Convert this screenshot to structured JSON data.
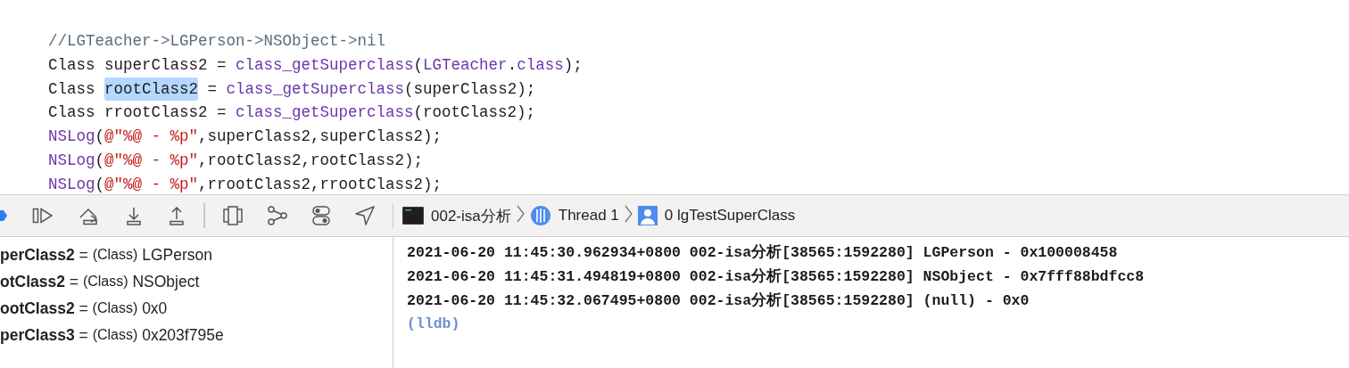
{
  "code_lines": [
    [
      {
        "kind": "comment",
        "text": "//LGTeacher->LGPerson->NSObject->nil"
      }
    ],
    [
      {
        "kind": "plain",
        "text": "Class superClass2 = "
      },
      {
        "kind": "func",
        "text": "class_getSuperclass"
      },
      {
        "kind": "plain",
        "text": "("
      },
      {
        "kind": "func",
        "text": "LGTeacher"
      },
      {
        "kind": "plain",
        "text": "."
      },
      {
        "kind": "func",
        "text": "class"
      },
      {
        "kind": "plain",
        "text": ");"
      }
    ],
    [
      {
        "kind": "plain",
        "text": "Class "
      },
      {
        "kind": "highlight",
        "text": "rootClass2"
      },
      {
        "kind": "plain",
        "text": " = "
      },
      {
        "kind": "func",
        "text": "class_getSuperclass"
      },
      {
        "kind": "plain",
        "text": "(superClass2);"
      }
    ],
    [
      {
        "kind": "plain",
        "text": "Class rrootClass2 = "
      },
      {
        "kind": "func",
        "text": "class_getSuperclass"
      },
      {
        "kind": "plain",
        "text": "(rootClass2);"
      }
    ],
    [
      {
        "kind": "func",
        "text": "NSLog"
      },
      {
        "kind": "plain",
        "text": "("
      },
      {
        "kind": "string",
        "text": "@\"%@ - %p\""
      },
      {
        "kind": "plain",
        "text": ",superClass2,superClass2);"
      }
    ],
    [
      {
        "kind": "func",
        "text": "NSLog"
      },
      {
        "kind": "plain",
        "text": "("
      },
      {
        "kind": "string",
        "text": "@\"%@ - %p\""
      },
      {
        "kind": "plain",
        "text": ",rootClass2,rootClass2);"
      }
    ],
    [
      {
        "kind": "func",
        "text": "NSLog"
      },
      {
        "kind": "plain",
        "text": "("
      },
      {
        "kind": "string",
        "text": "@\"%@ - %p\""
      },
      {
        "kind": "plain",
        "text": ",rrootClass2,rrootClass2);"
      }
    ]
  ],
  "debug_bar": {
    "tools": [
      {
        "kind": "breakpoints"
      },
      {
        "kind": "continue"
      },
      {
        "kind": "step-over"
      },
      {
        "kind": "step-into"
      },
      {
        "kind": "step-out"
      },
      {
        "kind": "separator"
      },
      {
        "kind": "view-debugger"
      },
      {
        "kind": "memory-graph"
      },
      {
        "kind": "environment"
      },
      {
        "kind": "location"
      },
      {
        "kind": "separator"
      }
    ],
    "breadcrumbs": [
      {
        "kind": "terminal",
        "label": "002-isa分析"
      },
      {
        "kind": "thread",
        "label": "Thread 1"
      },
      {
        "kind": "frame",
        "label": "0 lgTestSuperClass"
      }
    ]
  },
  "variables": [
    {
      "name": "perClass2",
      "equals": "=",
      "type": "(Class)",
      "value": "LGPerson"
    },
    {
      "name": "otClass2",
      "equals": "=",
      "type": "(Class)",
      "value": "NSObject"
    },
    {
      "name": "ootClass2",
      "equals": "=",
      "type": "(Class)",
      "value": "0x0"
    },
    {
      "name": "perClass3",
      "equals": "=",
      "type": "(Class)",
      "value": "0x203f795e"
    }
  ],
  "console": {
    "lines": [
      "2021-06-20 11:45:30.962934+0800 002-isa分析[38565:1592280] LGPerson - 0x100008458",
      "2021-06-20 11:45:31.494819+0800 002-isa分析[38565:1592280] NSObject - 0x7fff88bdfcc8",
      "2021-06-20 11:45:32.067495+0800 002-isa分析[38565:1592280] (null) - 0x0"
    ],
    "prompt": "(lldb)"
  }
}
